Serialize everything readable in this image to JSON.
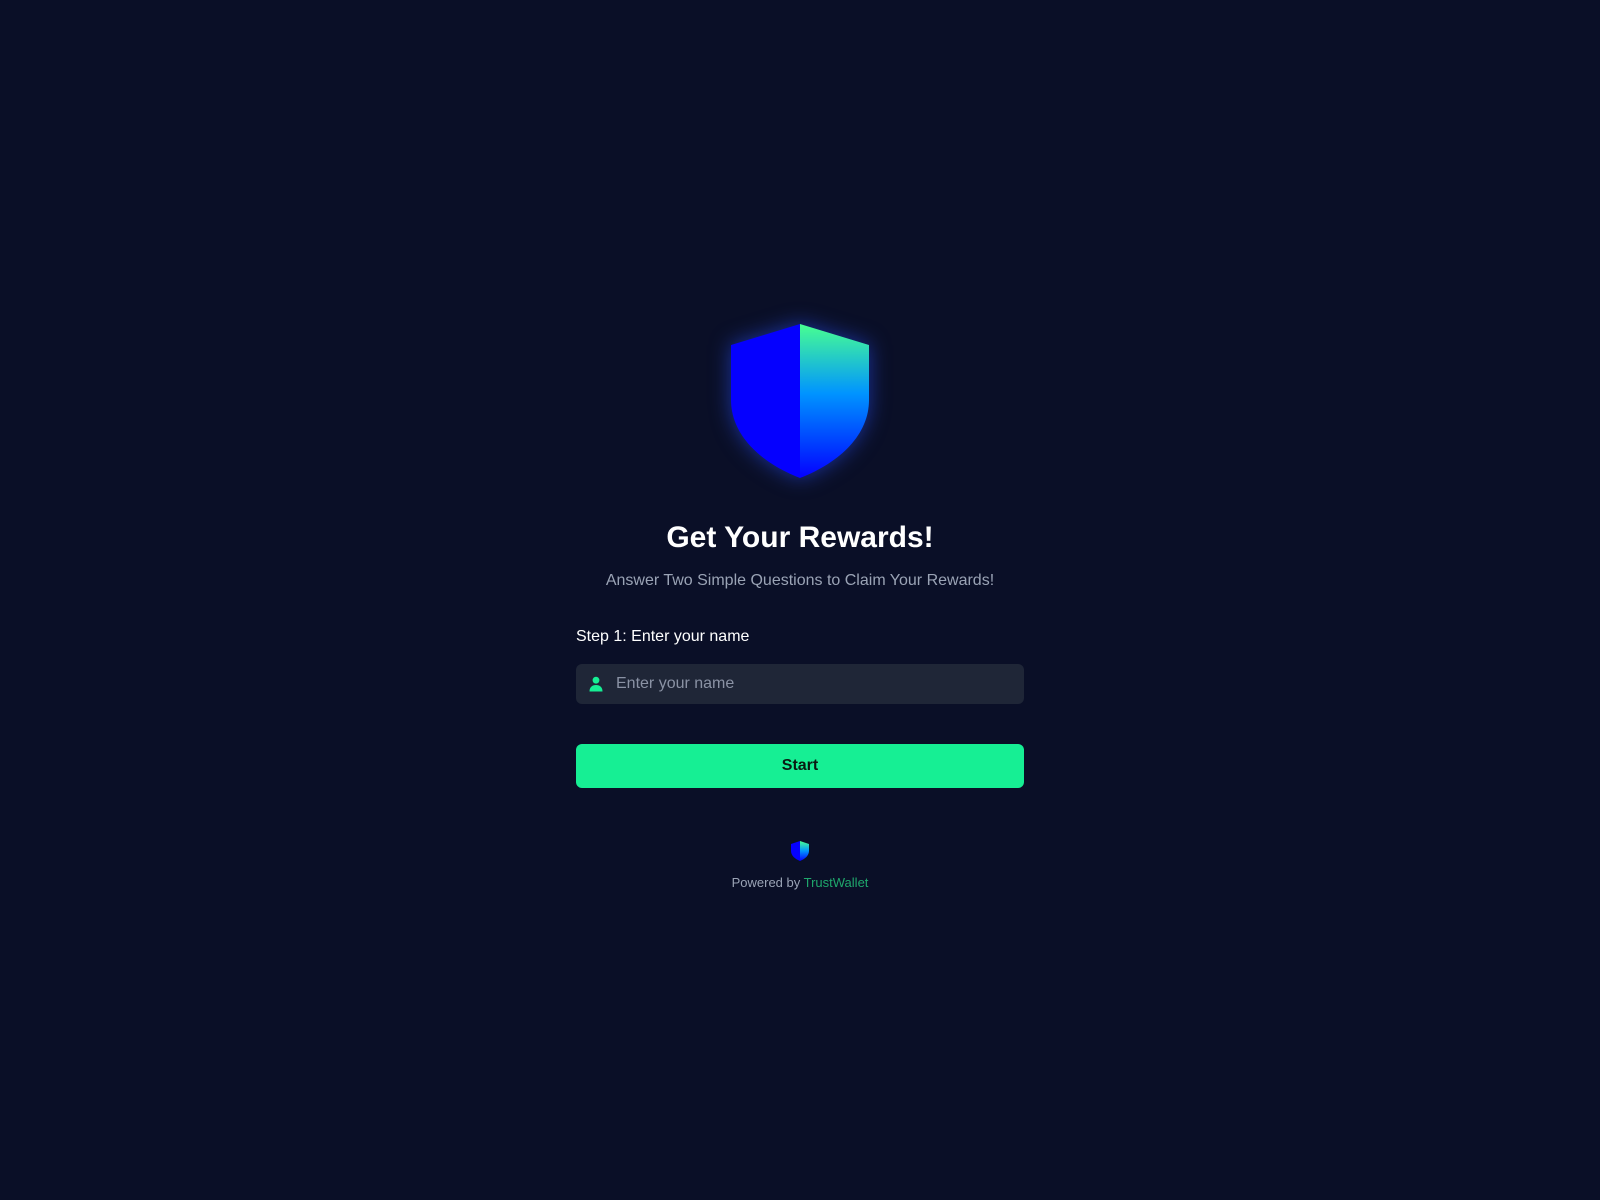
{
  "hero": {
    "logo_icon": "trustwallet-shield-icon",
    "title": "Get Your Rewards!",
    "subtitle": "Answer Two Simple Questions to Claim Your Rewards!"
  },
  "form": {
    "step_label": "Step 1: Enter your name",
    "name_field": {
      "icon": "user-icon",
      "value": "",
      "placeholder": "Enter your name"
    },
    "start_label": "Start"
  },
  "footer": {
    "logo_icon": "trustwallet-shield-icon",
    "powered_by": "Powered by",
    "brand": "TrustWallet"
  },
  "colors": {
    "background": "#0a0f27",
    "accent": "#16ef94",
    "input_background": "#1f2637",
    "shield_blue": "#0500ff",
    "shield_green": "#48ff91",
    "brand_link": "#1fa76c"
  }
}
